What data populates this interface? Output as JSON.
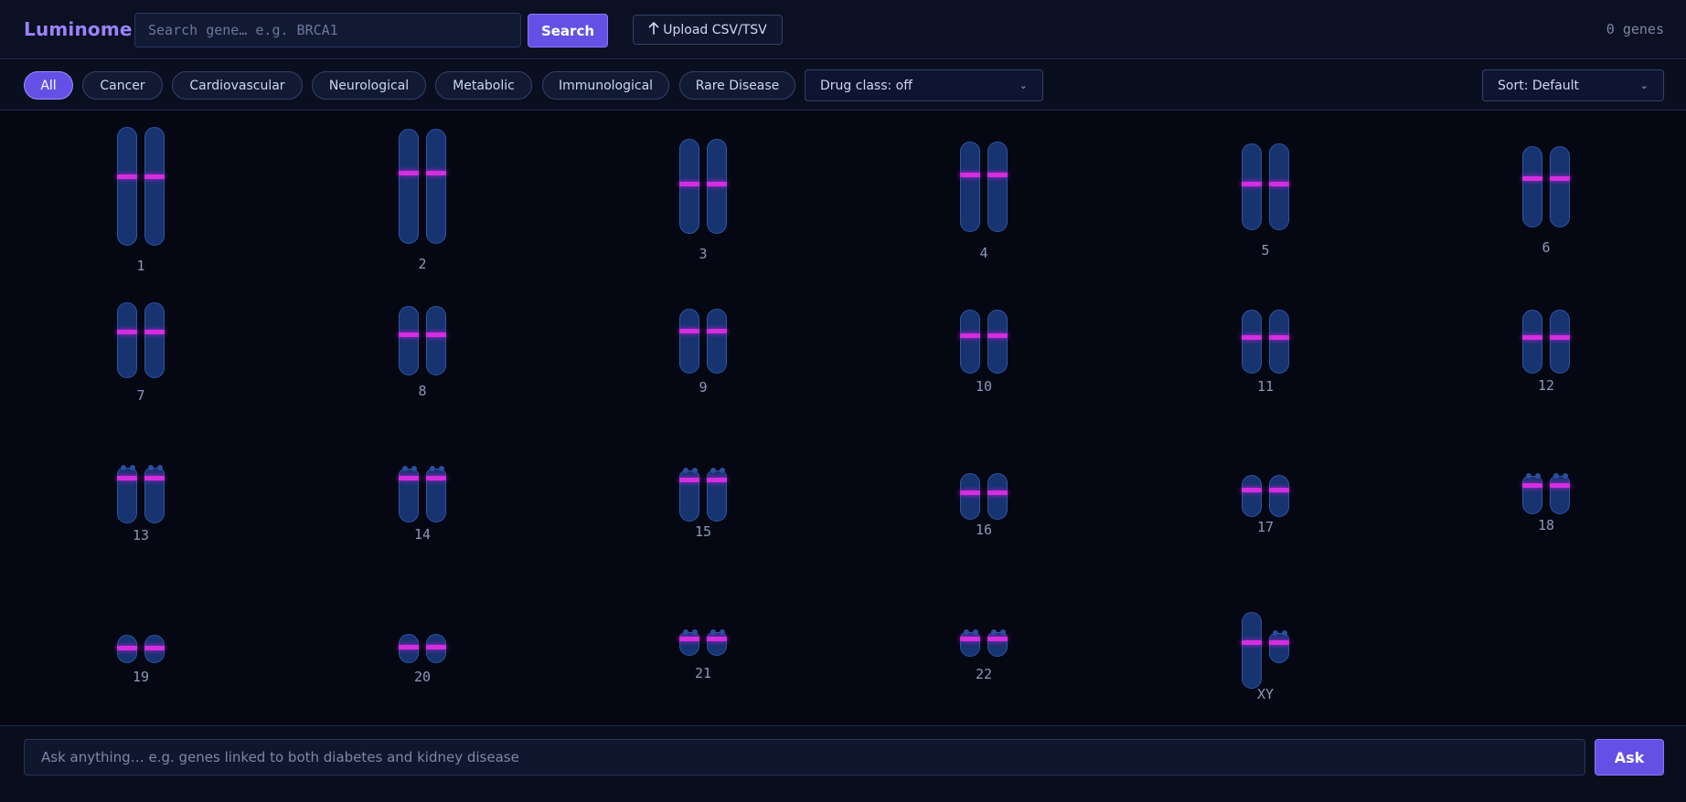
{
  "app": {
    "title": "Luminome"
  },
  "header": {
    "search_placeholder": "Search gene… e.g. BRCA1",
    "search_button": "Search",
    "upload_button": "Upload CSV/TSV",
    "upload_icon": "up-arrow-icon",
    "gene_count": "0 genes"
  },
  "filters": {
    "chips": [
      "All",
      "Cancer",
      "Cardiovascular",
      "Neurological",
      "Metabolic",
      "Immunological",
      "Rare Disease"
    ],
    "active_chip": "All",
    "drug_class": "Drug class: off",
    "sort": "Sort: Default"
  },
  "colors": {
    "accent": "#6550e6",
    "chromosome_fill": "#173370",
    "centromere_band": "#d42ee0",
    "background": "#050813"
  },
  "chromosomes": [
    {
      "label": "1"
    },
    {
      "label": "2"
    },
    {
      "label": "3"
    },
    {
      "label": "4"
    },
    {
      "label": "5"
    },
    {
      "label": "6"
    },
    {
      "label": "7"
    },
    {
      "label": "8"
    },
    {
      "label": "9"
    },
    {
      "label": "10"
    },
    {
      "label": "11"
    },
    {
      "label": "12"
    },
    {
      "label": "13"
    },
    {
      "label": "14"
    },
    {
      "label": "15"
    },
    {
      "label": "16"
    },
    {
      "label": "17"
    },
    {
      "label": "18"
    },
    {
      "label": "19"
    },
    {
      "label": "20"
    },
    {
      "label": "21"
    },
    {
      "label": "22"
    },
    {
      "label": "XY"
    }
  ],
  "ask": {
    "placeholder": "Ask anything… e.g. genes linked to both diabetes and kidney disease",
    "button": "Ask"
  }
}
